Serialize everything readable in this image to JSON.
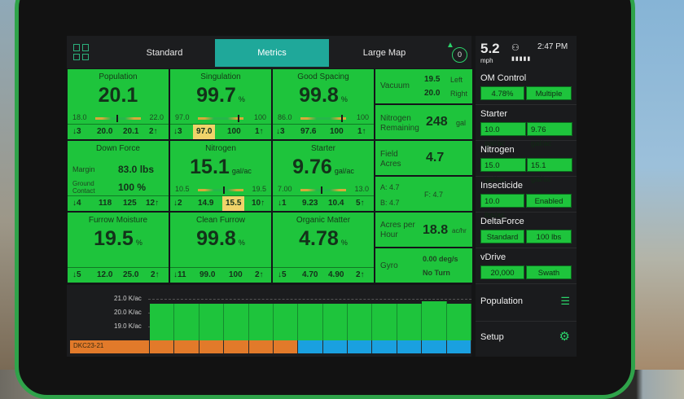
{
  "tabs": [
    {
      "label": "Standard"
    },
    {
      "label": "Metrics"
    },
    {
      "label": "Large Map"
    }
  ],
  "alerts": {
    "count": "0"
  },
  "status": {
    "speed": "5.2",
    "speed_unit": "mph",
    "time": "2:47 PM"
  },
  "metrics": {
    "population": {
      "title": "Population",
      "value": "20.1",
      "lo": "18.0",
      "hi": "22.0",
      "foot": [
        "↓3",
        "20.0",
        "20.1",
        "2↑"
      ]
    },
    "singulation": {
      "title": "Singulation",
      "value": "99.7",
      "unit": "%",
      "lo": "97.0",
      "hi": "100",
      "foot": [
        "↓3",
        "97.0",
        "100",
        "1↑"
      ]
    },
    "good_spacing": {
      "title": "Good Spacing",
      "value": "99.8",
      "unit": "%",
      "lo": "86.0",
      "hi": "100",
      "foot": [
        "↓3",
        "97.6",
        "100",
        "1↑"
      ]
    },
    "down_force": {
      "title": "Down Force",
      "margin_label": "Margin",
      "margin_value": "83.0 lbs",
      "contact_label": "Ground Contact",
      "contact_value": "100 %",
      "foot": [
        "↓4",
        "118",
        "125",
        "12↑"
      ]
    },
    "nitrogen": {
      "title": "Nitrogen",
      "value": "15.1",
      "unit": "gal/ac",
      "lo": "10.5",
      "hi": "19.5",
      "foot": [
        "↓2",
        "14.9",
        "15.5",
        "10↑"
      ]
    },
    "starter": {
      "title": "Starter",
      "value": "9.76",
      "unit": "gal/ac",
      "lo": "7.00",
      "hi": "13.0",
      "foot": [
        "↓1",
        "9.23",
        "10.4",
        "5↑"
      ]
    },
    "furrow_moisture": {
      "title": "Furrow Moisture",
      "value": "19.5",
      "unit": "%",
      "foot": [
        "↓5",
        "12.0",
        "25.0",
        "2↑"
      ]
    },
    "clean_furrow": {
      "title": "Clean Furrow",
      "value": "99.8",
      "unit": "%",
      "foot": [
        "↓11",
        "99.0",
        "100",
        "2↑"
      ]
    },
    "organic_matter": {
      "title": "Organic Matter",
      "value": "4.78",
      "unit": "%",
      "foot": [
        "↓5",
        "4.70",
        "4.90",
        "2↑"
      ]
    }
  },
  "right_metrics": {
    "vacuum": {
      "label": "Vacuum",
      "left_value": "19.5",
      "left_label": "Left",
      "right_value": "20.0",
      "right_label": "Right"
    },
    "nitrogen_remaining": {
      "label": "Nitrogen Remaining",
      "value": "248",
      "unit": "gal"
    },
    "field_acres": {
      "label": "Field Acres",
      "value": "4.7"
    },
    "abf": {
      "a": "A: 4.7",
      "b": "B: 4.7",
      "f": "F: 4.7"
    },
    "acres_per_hour": {
      "label": "Acres per Hour",
      "value": "18.8",
      "unit": "ac/hr"
    },
    "gyro": {
      "label": "Gyro",
      "rate": "0.00 deg/s",
      "state": "No Turn"
    }
  },
  "sidebar": [
    {
      "label": "OM Control",
      "chips": [
        "4.78%",
        "Multiple"
      ]
    },
    {
      "label": "Starter",
      "chips": [
        "10.0 gal/ac",
        "9.76 gal/ac"
      ]
    },
    {
      "label": "Nitrogen",
      "chips": [
        "15.0 gal/ac",
        "15.1 gal/ac"
      ]
    },
    {
      "label": "Insecticide",
      "chips": [
        "10.0 lbs/ac",
        "Enabled"
      ]
    },
    {
      "label": "DeltaForce",
      "chips": [
        "Standard",
        "100 lbs"
      ]
    },
    {
      "label": "vDrive",
      "chips": [
        "20,000",
        "Swath"
      ]
    }
  ],
  "sidebar_actions": {
    "population": "Population",
    "setup": "Setup"
  },
  "chart_data": {
    "type": "bar",
    "ylabels": [
      "21.0 K/ac",
      "20.0 K/ac",
      "19.0 K/ac"
    ],
    "yticks": [
      21.0,
      20.0,
      19.0
    ],
    "ylim": [
      18.0,
      21.0
    ],
    "values": [
      20.0,
      20.0,
      20.0,
      20.0,
      20.0,
      20.0,
      20.0,
      20.0,
      20.0,
      20.0,
      20.0,
      20.1,
      20.0
    ],
    "hybrid_label": "DKC23-21",
    "colors": {
      "bar": "#1ec43c",
      "strip_a": "#e27a2a",
      "strip_b": "#1aa0e0"
    }
  }
}
